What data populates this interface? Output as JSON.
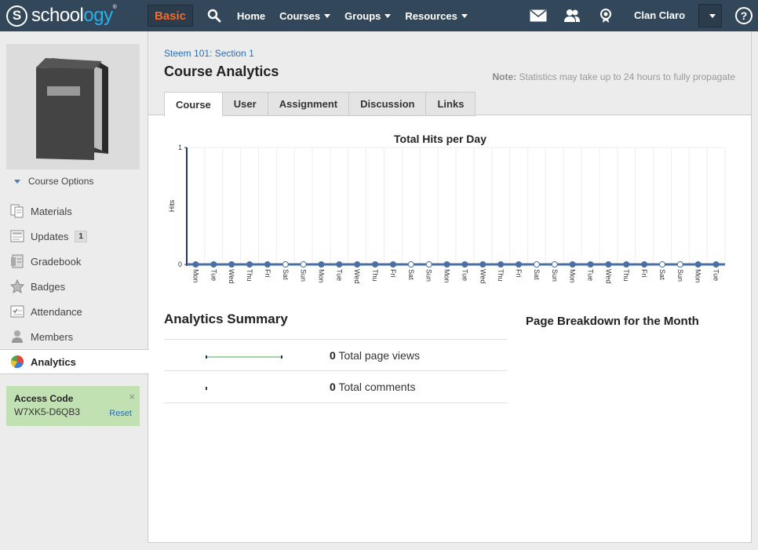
{
  "topbar": {
    "logo_s": "S",
    "logo_text_a": "school",
    "logo_text_b": "ogy",
    "logo_tm": "®",
    "badge": "Basic",
    "nav": [
      {
        "label": "Home"
      },
      {
        "label": "Courses"
      },
      {
        "label": "Groups"
      },
      {
        "label": "Resources"
      }
    ],
    "user_name": "Clan Claro",
    "help": "?"
  },
  "sidebar": {
    "course_options": "Course Options",
    "items": [
      {
        "label": "Materials",
        "icon": "materials-icon"
      },
      {
        "label": "Updates",
        "icon": "updates-icon",
        "count": "1"
      },
      {
        "label": "Gradebook",
        "icon": "gradebook-icon"
      },
      {
        "label": "Badges",
        "icon": "badge-icon"
      },
      {
        "label": "Attendance",
        "icon": "attendance-icon"
      },
      {
        "label": "Members",
        "icon": "members-icon"
      },
      {
        "label": "Analytics",
        "icon": "analytics-icon"
      }
    ],
    "access": {
      "title": "Access Code",
      "code": "W7XK5-D6QB3",
      "reset": "Reset",
      "close": "×"
    }
  },
  "main": {
    "breadcrumb": "Steem 101: Section 1",
    "title": "Course Analytics",
    "note_label": "Note:",
    "note_text": "Statistics may take up to 24 hours to fully propagate",
    "tabs": [
      {
        "label": "Course"
      },
      {
        "label": "User"
      },
      {
        "label": "Assignment"
      },
      {
        "label": "Discussion"
      },
      {
        "label": "Links"
      }
    ],
    "summary_title": "Analytics Summary",
    "summary": [
      {
        "value": "0",
        "label": "Total page views"
      },
      {
        "value": "0",
        "label": "Total comments"
      }
    ],
    "breakdown_title": "Page Breakdown for the Month"
  },
  "chart_data": {
    "type": "line",
    "title": "Total Hits per Day",
    "ylabel": "Hits",
    "ylim": [
      0,
      1
    ],
    "yticks": [
      "0",
      "1"
    ],
    "categories": [
      "Mon",
      "Tue",
      "Wed",
      "Thu",
      "Fri",
      "Sat",
      "Sun",
      "Mon",
      "Tue",
      "Wed",
      "Thu",
      "Fri",
      "Sat",
      "Sun",
      "Mon",
      "Tue",
      "Wed",
      "Thu",
      "Fri",
      "Sat",
      "Sun",
      "Mon",
      "Tue",
      "Wed",
      "Thu",
      "Fri",
      "Sat",
      "Sun",
      "Mon",
      "Tue"
    ],
    "values": [
      0,
      0,
      0,
      0,
      0,
      0,
      0,
      0,
      0,
      0,
      0,
      0,
      0,
      0,
      0,
      0,
      0,
      0,
      0,
      0,
      0,
      0,
      0,
      0,
      0,
      0,
      0,
      0,
      0,
      0
    ],
    "weekend": [
      false,
      false,
      false,
      false,
      false,
      true,
      true,
      false,
      false,
      false,
      false,
      false,
      true,
      true,
      false,
      false,
      false,
      false,
      false,
      true,
      true,
      false,
      false,
      false,
      false,
      false,
      true,
      true,
      false,
      false
    ],
    "colors": {
      "line": "#4a6fa5",
      "weekday_marker": "#4a6fa5",
      "weekend_marker": "#ffffff"
    }
  }
}
